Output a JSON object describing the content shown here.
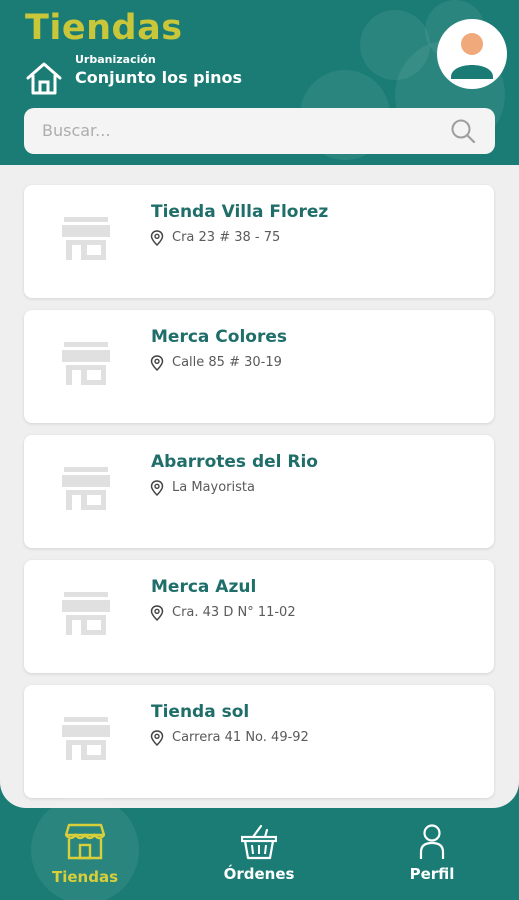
{
  "header": {
    "title": "Tiendas",
    "urbanizacion_label": "Urbanización",
    "urbanizacion_name": "Conjunto los pinos"
  },
  "search": {
    "placeholder": "Buscar..."
  },
  "stores": [
    {
      "name": "Tienda Villa Florez",
      "address": "Cra 23 # 38 - 75"
    },
    {
      "name": "Merca Colores",
      "address": "Calle 85 # 30-19"
    },
    {
      "name": "Abarrotes del Rio",
      "address": "La Mayorista"
    },
    {
      "name": "Merca Azul",
      "address": " Cra. 43 D N° 11-02"
    },
    {
      "name": "Tienda sol",
      "address": "Carrera 41 No. 49-92"
    }
  ],
  "nav": {
    "tiendas": "Tiendas",
    "ordenes": "Órdenes",
    "perfil": "Perfil"
  },
  "colors": {
    "primary": "#1a7c75",
    "accent": "#c9c63a",
    "store_name": "#1f6e6a",
    "panel_bg": "#efefef"
  },
  "icons": [
    "home-icon",
    "avatar-icon",
    "search-icon",
    "store-icon",
    "pin-icon",
    "shop-icon",
    "basket-icon",
    "person-icon"
  ]
}
